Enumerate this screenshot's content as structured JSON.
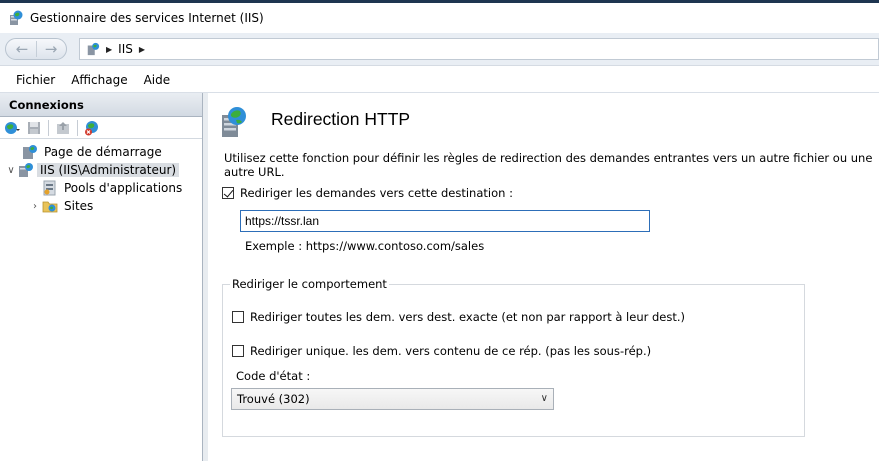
{
  "window": {
    "title": "Gestionnaire des services Internet (IIS)"
  },
  "address": {
    "segments": [
      "IIS"
    ]
  },
  "menu": {
    "items": [
      "Fichier",
      "Affichage",
      "Aide"
    ]
  },
  "connections": {
    "header": "Connexions",
    "tree": [
      {
        "label": "Page de démarrage",
        "icon": "start-page-icon"
      },
      {
        "label": "IIS (IIS\\Administrateur)",
        "icon": "server-icon",
        "expanded": true,
        "selected": true
      },
      {
        "label": "Pools d'applications",
        "icon": "app-pools-icon"
      },
      {
        "label": "Sites",
        "icon": "sites-folder-icon"
      }
    ]
  },
  "feature": {
    "title": "Redirection HTTP",
    "description": "Utilisez cette fonction pour définir les règles de redirection des demandes entrantes vers un autre fichier ou une autre URL.",
    "redirect_checkbox_label": "Rediriger les demandes vers cette destination :",
    "redirect_checked": true,
    "destination_value": "https://tssr.lan",
    "example": "Exemple : https://www.contoso.com/sales",
    "behavior_group": "Rediriger le comportement",
    "exact_label": "Rediriger toutes les dem. vers dest. exacte (et non par rapport à leur dest.)",
    "exact_checked": false,
    "unique_label": "Rediriger unique. les dem. vers contenu de ce rép. (pas les sous-rép.)",
    "unique_checked": false,
    "status_label": "Code d'état :",
    "status_value": "Trouvé (302)"
  }
}
